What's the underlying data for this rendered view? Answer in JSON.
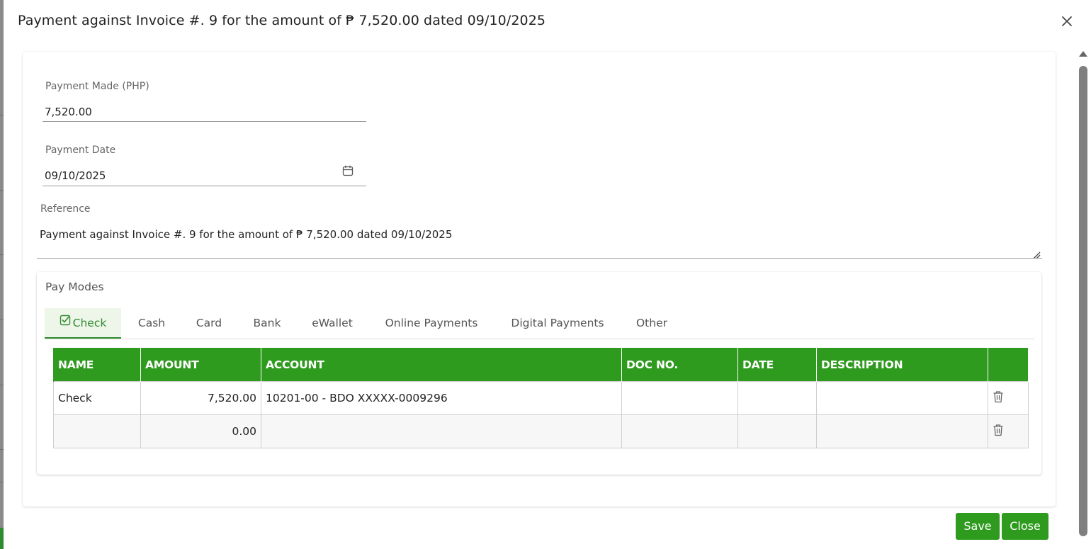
{
  "dialog": {
    "title": "Payment against Invoice #. 9 for the amount of ₱ 7,520.00 dated 09/10/2025",
    "close_icon": "close-icon"
  },
  "form": {
    "payment_made_label": "Payment Made (PHP)",
    "payment_made_value": "7,520.00",
    "payment_date_label": "Payment Date",
    "payment_date_value": "09/10/2025",
    "reference_label": "Reference",
    "reference_value": "Payment against Invoice #. 9 for the amount of ₱ 7,520.00 dated 09/10/2025"
  },
  "paymodes": {
    "title": "Pay Modes",
    "tabs": [
      {
        "label": "Check",
        "active": true
      },
      {
        "label": "Cash"
      },
      {
        "label": "Card"
      },
      {
        "label": "Bank"
      },
      {
        "label": "eWallet"
      },
      {
        "label": "Online Payments"
      },
      {
        "label": "Digital Payments"
      },
      {
        "label": "Other"
      }
    ],
    "table": {
      "headers": [
        "NAME",
        "AMOUNT",
        "ACCOUNT",
        "DOC NO.",
        "DATE",
        "DESCRIPTION",
        ""
      ],
      "rows": [
        {
          "name": "Check",
          "amount": "7,520.00",
          "account": "10201-00 - BDO XXXXX-0009296",
          "doc_no": "",
          "date": "",
          "description": ""
        },
        {
          "name": "",
          "amount": "0.00",
          "account": "",
          "doc_no": "",
          "date": "",
          "description": ""
        }
      ]
    }
  },
  "buttons": {
    "save": "Save",
    "close": "Close"
  },
  "colors": {
    "accent": "#2e9b1e",
    "tab_active_bg": "#eef6ea"
  }
}
